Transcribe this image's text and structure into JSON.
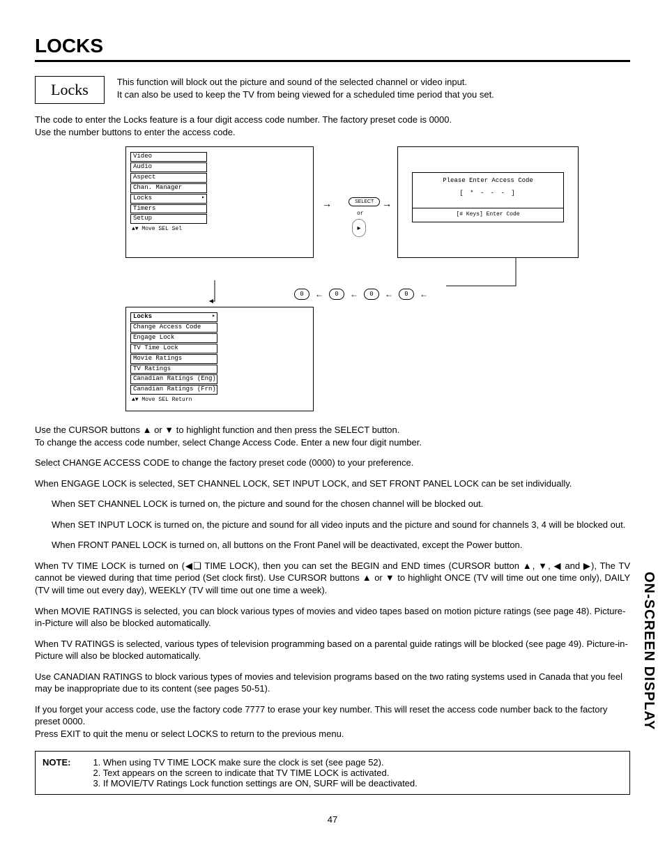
{
  "page_number": "47",
  "side_label": "ON-SCREEN DISPLAY",
  "section_title": "LOCKS",
  "locks_box_label": "Locks",
  "intro_p1": "This function will block out the picture and sound of the selected channel or video input.",
  "intro_p2": "It can also be used to keep the TV from being viewed for a scheduled time period that you set.",
  "intro_p3": "The code to enter the Locks feature is a four digit access code number.  The factory preset code is 0000.",
  "intro_p4": "Use the number buttons to enter the access code.",
  "menu1": {
    "items": [
      "Video",
      "Audio",
      "Aspect",
      "Chan. Manager",
      "Locks",
      "Timers",
      "Setup"
    ],
    "footer": "▲▼ Move  SEL Sel"
  },
  "select_label": "SELECT",
  "or_label": "or",
  "access": {
    "title": "Please Enter Access Code",
    "code_display": "[ * - - - ]",
    "helper": "[# Keys] Enter Code"
  },
  "zero_label": "0",
  "menu2": {
    "header": "Locks",
    "items": [
      "Change Access Code",
      "Engage Lock",
      "TV Time Lock",
      "Movie Ratings",
      "TV Ratings",
      "Canadian Ratings (Eng)",
      "Canadian Ratings (Frn)"
    ],
    "footer": "▲▼ Move  SEL Return"
  },
  "body": {
    "p1a": "Use the CURSOR buttons ▲ or ▼ to highlight function and then press the SELECT button.",
    "p1b": "To change the access code number, select Change Access Code.  Enter a new four digit number.",
    "p2": "Select CHANGE ACCESS CODE to change the factory preset code (0000) to your preference.",
    "p3": "When ENGAGE LOCK is selected, SET CHANNEL LOCK, SET INPUT LOCK, and SET FRONT PANEL LOCK can be set individually.",
    "p3a": "When SET CHANNEL LOCK is turned on, the picture and sound for the chosen channel will be blocked out.",
    "p3b": "When SET INPUT LOCK is turned on, the picture and sound for all video inputs and the picture and sound for channels 3, 4 will be blocked out.",
    "p3c": "When FRONT PANEL LOCK is turned on, all buttons on the Front Panel will be deactivated, except the Power button.",
    "p4": "When TV TIME LOCK is turned on (◀❏ TIME LOCK), then you can set the BEGIN and END times (CURSOR button ▲, ▼, ◀ and ▶), The TV cannot be viewed during that time period (Set clock first). Use CURSOR buttons ▲ or ▼ to highlight ONCE (TV will time out one time only), DAILY (TV will time out every day), WEEKLY (TV will time out one time a week).",
    "p5": "When MOVIE RATINGS is selected, you can block various types of movies and video tapes based on motion picture ratings (see page 48). Picture-in-Picture will also be blocked automatically.",
    "p6": "When TV RATINGS is selected, various types of television programming based on a parental guide ratings will be blocked (see page 49). Picture-in-Picture will also be blocked automatically.",
    "p7": "Use CANADIAN RATINGS to block various types of movies and television programs based on the two rating systems used in Canada that you feel may be inappropriate due to its content (see pages 50-51).",
    "p8": "If you forget your access code, use the factory code 7777 to erase your key number. This will reset the access code number back to the factory preset 0000.",
    "p9": "Press EXIT to quit the menu or select LOCKS to return to the previous menu."
  },
  "note": {
    "label": "NOTE:",
    "n1": "1. When using TV TIME LOCK make sure the clock is set (see page 52).",
    "n2": "2. Text appears on the screen to indicate that TV TIME LOCK is activated.",
    "n3": "3. If MOVIE/TV Ratings Lock function settings are ON, SURF will be deactivated."
  }
}
